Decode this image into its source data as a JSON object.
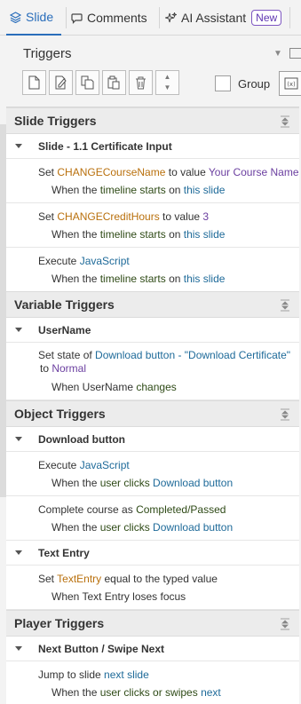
{
  "tabs": [
    {
      "label": "Slide",
      "icon": "slide-layers-icon",
      "active": true
    },
    {
      "label": "Comments",
      "icon": "comment-icon",
      "active": false
    },
    {
      "label": "AI Assistant",
      "icon": "sparkle-icon",
      "badge": "New",
      "active": false
    }
  ],
  "panel": {
    "title": "Triggers",
    "toolbar": {
      "buttons": [
        "new-trigger-icon",
        "edit-trigger-icon",
        "copy-icon",
        "paste-icon",
        "delete-icon",
        "move-up-down-icon"
      ],
      "group_label": "Group"
    }
  },
  "sections": {
    "slide": {
      "title": "Slide Triggers",
      "group": "Slide - 1.1 Certificate Input",
      "t1": {
        "pre": "Set ",
        "var": "CHANGECourseName",
        "mid": " to value ",
        "val": "Your Course Name",
        "when": "When the ",
        "event": "timeline starts",
        "on": " on ",
        "target": "this slide"
      },
      "t2": {
        "pre": "Set ",
        "var": "CHANGECreditHours",
        "mid": " to value ",
        "val": "3",
        "when": "When the ",
        "event": "timeline starts",
        "on": " on ",
        "target": "this slide"
      },
      "t3": {
        "pre": "Execute ",
        "action": "JavaScript",
        "when": "When the ",
        "event": "timeline starts",
        "on": " on ",
        "target": "this slide"
      }
    },
    "variable": {
      "title": "Variable Triggers",
      "group": "UserName",
      "t1": {
        "pre": "Set state of ",
        "object": "Download button - \"Download Certificate\"",
        "to": " to ",
        "state": "Normal",
        "when": "When UserName ",
        "event": "changes"
      }
    },
    "object": {
      "title": "Object Triggers",
      "group1": "Download button",
      "t1": {
        "pre": "Execute ",
        "action": "JavaScript",
        "when": "When the ",
        "event": "user clicks",
        "target": " Download button"
      },
      "t2": {
        "pre": "Complete course as ",
        "status": "Completed/Passed",
        "when": "When the ",
        "event": "user clicks",
        "target": " Download button"
      },
      "group2": "Text Entry",
      "t3": {
        "pre": "Set ",
        "var": "TextEntry",
        "mid": " equal to the typed value",
        "when": "When Text Entry loses focus"
      }
    },
    "player": {
      "title": "Player Triggers",
      "group": "Next Button / Swipe Next",
      "t1": {
        "pre": "Jump to slide ",
        "target": "next slide",
        "when": "When the ",
        "event": "user clicks or swipes",
        "target2": " next"
      }
    }
  },
  "colors": {
    "accent": "#2a6ebb",
    "variable": "#b9700d",
    "link": "#1e6a99",
    "value": "#6b3fa0",
    "badge": "#7e57c2"
  }
}
